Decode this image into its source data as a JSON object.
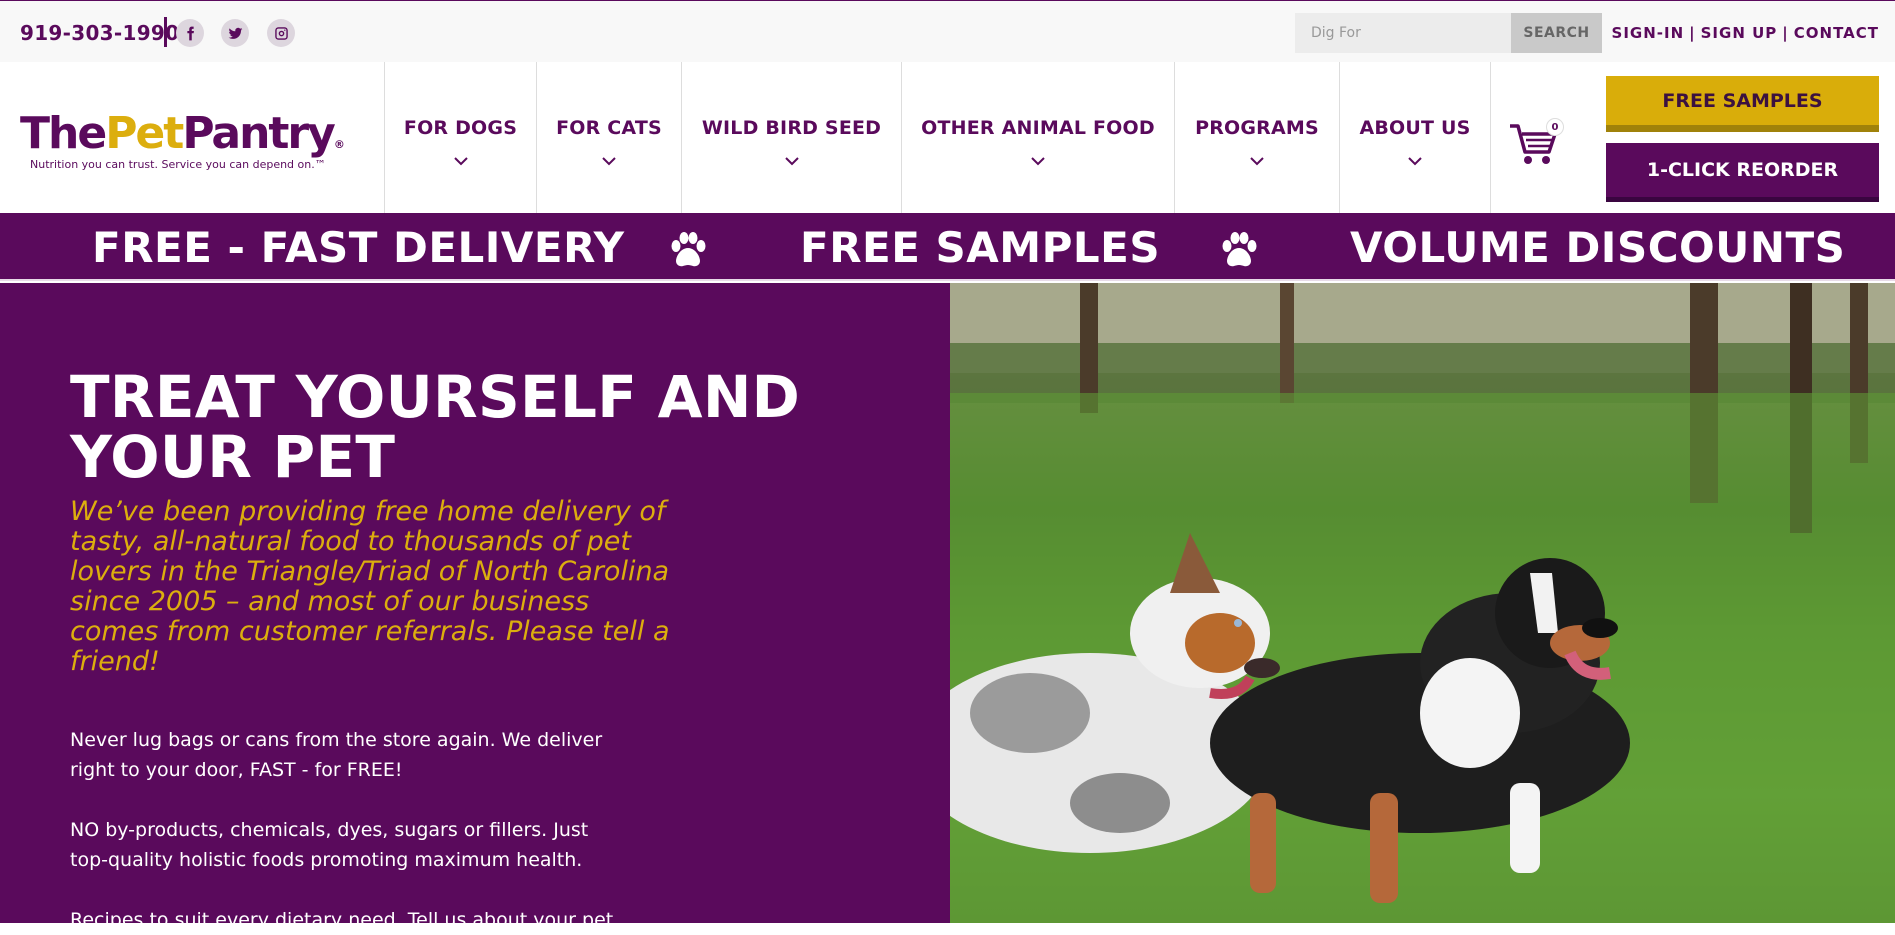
{
  "topbar": {
    "phone": "919-303-1990",
    "social": [
      "facebook-icon",
      "twitter-icon",
      "instagram-icon"
    ],
    "search": {
      "placeholder": "Dig For",
      "button_label": "SEARCH"
    },
    "links": {
      "sign_in": "SIGN-IN",
      "sign_up": "SIGN UP",
      "contact": "CONTACT"
    }
  },
  "logo": {
    "part1": "The",
    "part2": "Pet",
    "part3": "Pantry",
    "registered": "®",
    "tagline": "Nutrition you can trust. Service you can depend on.™"
  },
  "nav": {
    "items": [
      {
        "label": "FOR DOGS"
      },
      {
        "label": "FOR CATS"
      },
      {
        "label": "WILD BIRD SEED"
      },
      {
        "label": "OTHER ANIMAL FOOD"
      },
      {
        "label": "PROGRAMS"
      },
      {
        "label": "ABOUT US"
      }
    ],
    "cart_count": "0",
    "free_samples_label": "FREE SAMPLES",
    "reorder_label": "1-CLICK REORDER"
  },
  "promo": {
    "items": [
      "FREE - FAST DELIVERY",
      "FREE SAMPLES",
      "VOLUME DISCOUNTS"
    ]
  },
  "hero": {
    "title": "TREAT YOURSELF AND YOUR PET",
    "subtitle": "We’ve been providing free home delivery of tasty, all-natural food to thousands of pet lovers in the Triangle/Triad of North Carolina since 2005 – and most of our business comes from customer referrals. Please tell a friend!",
    "paragraphs": [
      "Never lug bags or cans from the store again. We deliver right to your door, FAST - for FREE!",
      "NO by-products, chemicals, dyes, sugars or fillers. Just top-quality holistic foods promoting maximum health.",
      "Recipes to suit every dietary need. Tell us about your pet"
    ]
  },
  "colors": {
    "brand_purple": "#5a0a5c",
    "brand_gold": "#dcae0e"
  }
}
